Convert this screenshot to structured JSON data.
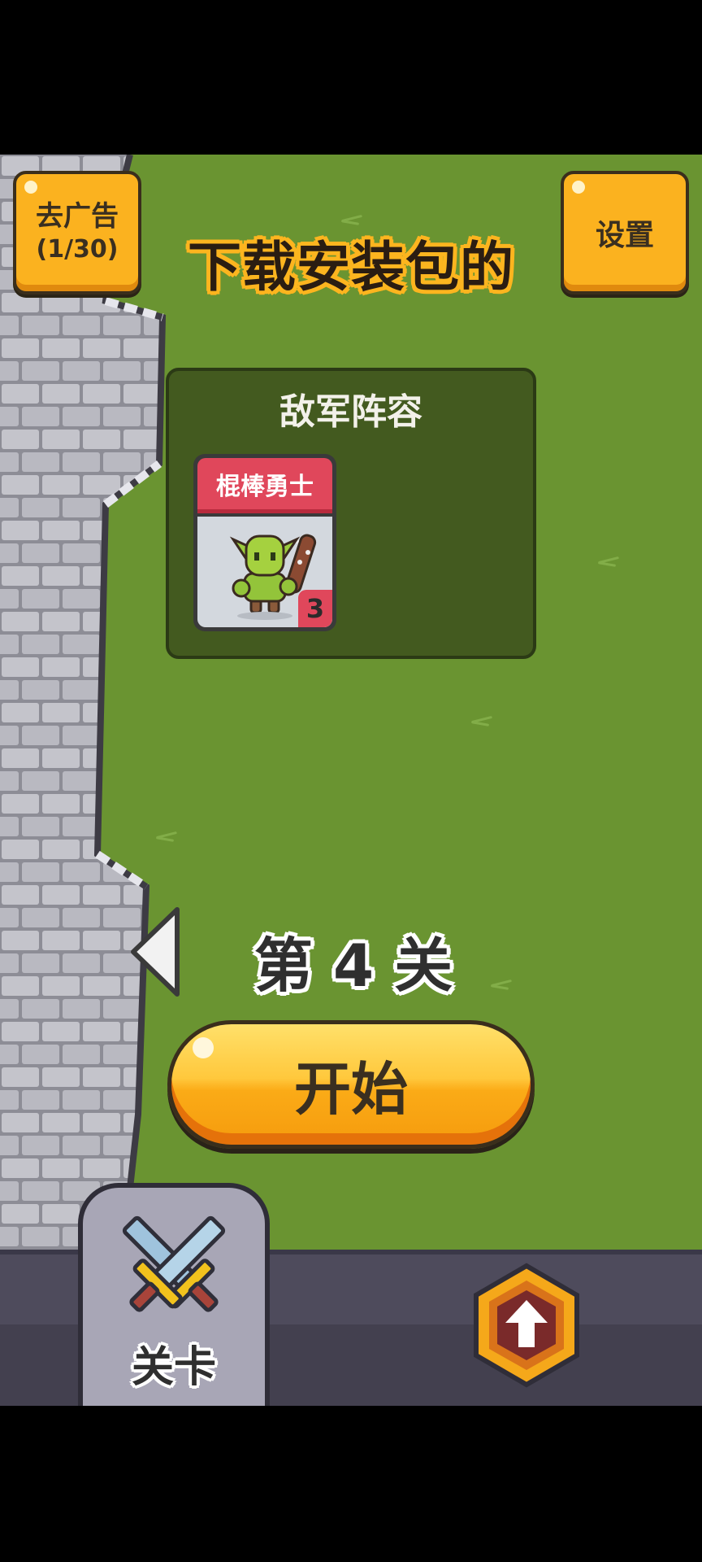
{
  "header": {
    "remove_ads_label": "去广告",
    "remove_ads_count": "(1/30)",
    "settings_label": "设置",
    "title": "下载安装包的"
  },
  "enemy_panel": {
    "heading": "敌军阵容",
    "units": [
      {
        "name": "棍棒勇士",
        "count": "3"
      }
    ]
  },
  "level": {
    "label": "第 4 关",
    "start_label": "开始"
  },
  "bottom_nav": {
    "levels_label": "关卡"
  },
  "colors": {
    "grass": "#6a9431",
    "accent_yellow": "#fbb21f",
    "card_red": "#e0475b"
  }
}
